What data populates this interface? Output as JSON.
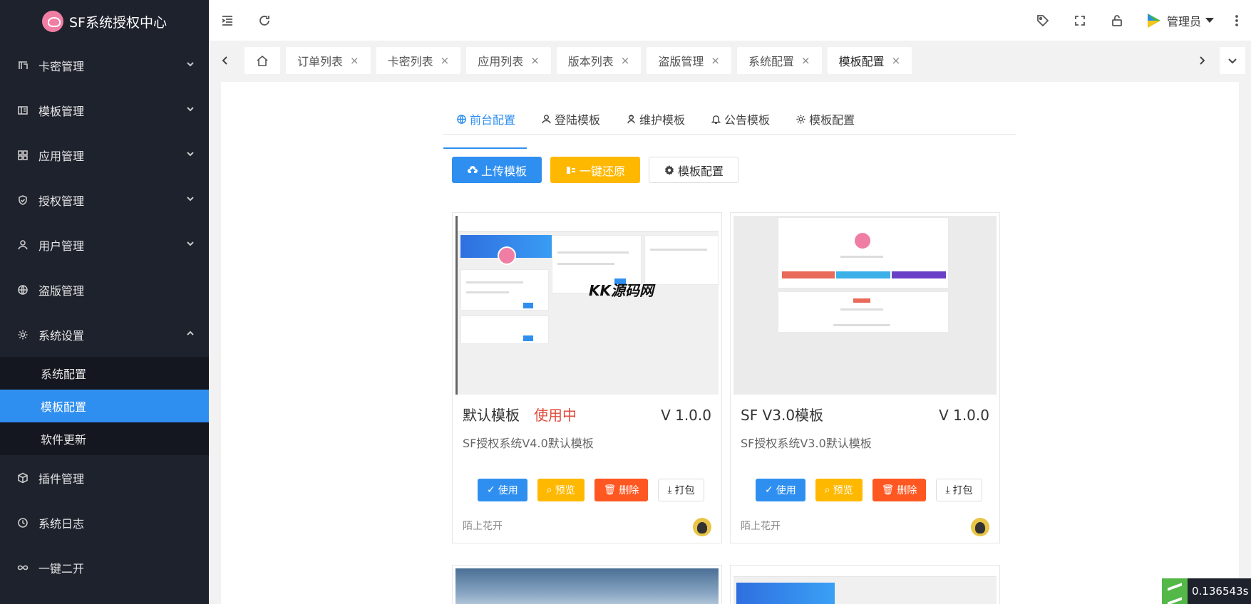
{
  "brand": {
    "title": "SF系统授权中心"
  },
  "sidebar": {
    "items": [
      {
        "label": "卡密管理",
        "icon": "card-icon",
        "expanded": false
      },
      {
        "label": "模板管理",
        "icon": "template-icon",
        "expanded": false
      },
      {
        "label": "应用管理",
        "icon": "apps-icon",
        "expanded": false
      },
      {
        "label": "授权管理",
        "icon": "shield-icon",
        "expanded": false
      },
      {
        "label": "用户管理",
        "icon": "user-icon",
        "expanded": false
      },
      {
        "label": "盗版管理",
        "icon": "globe-icon",
        "expanded": false
      },
      {
        "label": "系统设置",
        "icon": "gear-icon",
        "expanded": true
      },
      {
        "label": "插件管理",
        "icon": "box-icon",
        "expanded": false
      },
      {
        "label": "系统日志",
        "icon": "clock-icon",
        "expanded": false
      },
      {
        "label": "一键二开",
        "icon": "infinity-icon",
        "expanded": false
      }
    ],
    "submenu": [
      {
        "label": "系统配置",
        "active": false
      },
      {
        "label": "模板配置",
        "active": true
      },
      {
        "label": "软件更新",
        "active": false
      }
    ]
  },
  "header": {
    "admin_name": "管理员"
  },
  "tabs": [
    {
      "label": "订单列表"
    },
    {
      "label": "卡密列表"
    },
    {
      "label": "应用列表"
    },
    {
      "label": "版本列表"
    },
    {
      "label": "盗版管理"
    },
    {
      "label": "系统配置"
    },
    {
      "label": "模板配置",
      "active": true
    }
  ],
  "subtabs": [
    {
      "label": "前台配置",
      "icon": "globe-icon",
      "active": true
    },
    {
      "label": "登陆模板",
      "icon": "user-icon"
    },
    {
      "label": "维护模板",
      "icon": "maintenance-icon"
    },
    {
      "label": "公告模板",
      "icon": "bell-icon"
    },
    {
      "label": "模板配置",
      "icon": "gear-icon"
    }
  ],
  "actions": {
    "upload": "上传模板",
    "restore": "一键还原",
    "config": "模板配置"
  },
  "cards": [
    {
      "name": "默认模板",
      "status": "使用中",
      "version": "V 1.0.0",
      "desc": "SF授权系统V4.0默认模板",
      "author": "陌上花开",
      "btn_use": "使用",
      "btn_preview": "预览",
      "btn_delete": "删除",
      "btn_pack": "打包"
    },
    {
      "name": "SF V3.0模板",
      "status": "",
      "version": "V 1.0.0",
      "desc": "SF授权系统V3.0默认模板",
      "author": "陌上花开",
      "btn_use": "使用",
      "btn_preview": "预览",
      "btn_delete": "删除",
      "btn_pack": "打包"
    }
  ],
  "watermark": "KK源码网",
  "perf": {
    "time": "0.136543s"
  },
  "colors": {
    "primary": "#2f8ff0",
    "warning": "#ffb800",
    "danger": "#ff5722",
    "sidebar": "#1e222d",
    "status": "#e04b3c"
  }
}
